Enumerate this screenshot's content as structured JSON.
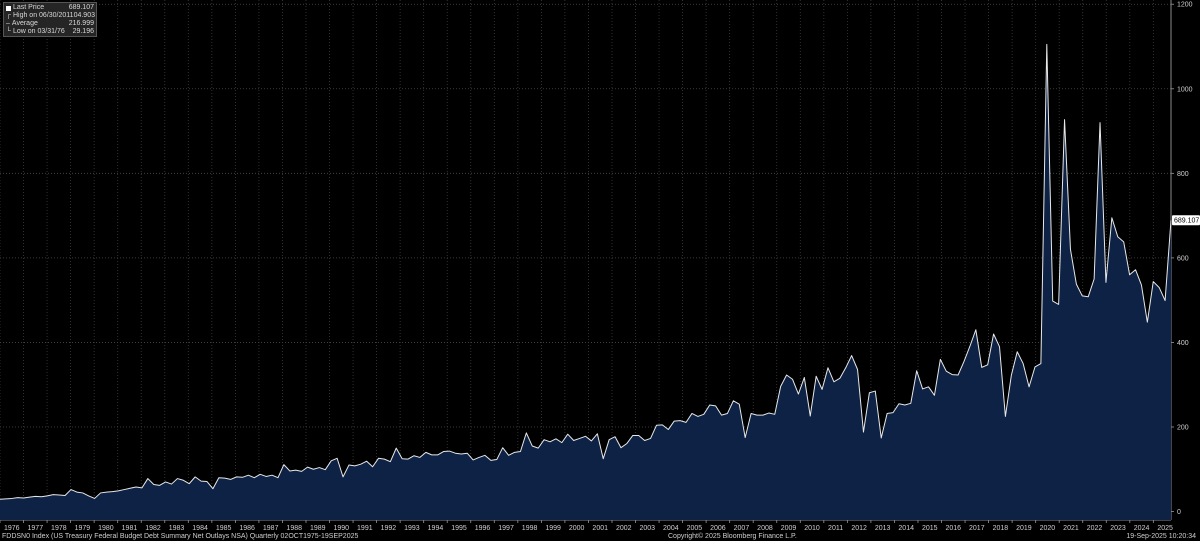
{
  "chart_data": {
    "type": "area",
    "x_start": 1976.0,
    "x_end": 2025.75,
    "x_tick_labels": [
      "1976",
      "1977",
      "1978",
      "1979",
      "1980",
      "1981",
      "1982",
      "1983",
      "1984",
      "1985",
      "1986",
      "1987",
      "1988",
      "1989",
      "1990",
      "1991",
      "1992",
      "1993",
      "1994",
      "1995",
      "1996",
      "1997",
      "1998",
      "1999",
      "2000",
      "2001",
      "2002",
      "2003",
      "2004",
      "2005",
      "2006",
      "2007",
      "2008",
      "2009",
      "2010",
      "2011",
      "2012",
      "2013",
      "2014",
      "2015",
      "2016",
      "2017",
      "2018",
      "2019",
      "2020",
      "2021",
      "2022",
      "2023",
      "2024",
      "2025"
    ],
    "ylim": [
      -20,
      1210
    ],
    "y_ticks": [
      0,
      200,
      400,
      600,
      800,
      1000,
      1200
    ],
    "grid": true,
    "fill_color": "#0d2244",
    "line_color": "#e8e8e8",
    "series": [
      {
        "values": [
          29.196,
          30,
          31,
          33,
          32,
          34,
          36,
          35,
          37,
          40,
          39,
          38,
          52,
          46,
          44,
          37,
          31,
          44,
          46,
          47,
          49,
          52,
          55,
          58,
          56,
          78,
          64,
          62,
          70,
          65,
          78,
          74,
          66,
          82,
          72,
          71,
          54,
          80,
          79,
          76,
          82,
          81,
          86,
          80,
          88,
          83,
          86,
          80,
          111,
          96,
          98,
          95,
          105,
          100,
          104,
          99,
          120,
          126,
          82,
          110,
          108,
          112,
          119,
          106,
          126,
          124,
          118,
          150,
          125,
          124,
          132,
          128,
          140,
          134,
          134,
          142,
          143,
          138,
          136,
          138,
          122,
          128,
          133,
          121,
          123,
          151,
          133,
          140,
          142,
          186,
          155,
          150,
          170,
          165,
          172,
          163,
          183,
          168,
          173,
          178,
          167,
          184,
          125,
          170,
          177,
          151,
          161,
          180,
          180,
          168,
          173,
          204,
          205,
          194,
          214,
          215,
          211,
          232,
          225,
          230,
          252,
          250,
          228,
          232,
          262,
          254,
          175,
          232,
          228,
          228,
          233,
          230,
          296,
          323,
          313,
          278,
          317,
          226,
          320,
          289,
          340,
          307,
          315,
          340,
          369,
          336,
          188,
          281,
          285,
          174,
          232,
          234,
          255,
          252,
          256,
          333,
          290,
          295,
          275,
          360,
          332,
          324,
          323,
          355,
          391,
          430,
          341,
          347,
          420,
          390,
          225,
          322,
          378,
          350,
          295,
          342,
          350,
          1104.903,
          498,
          490,
          927,
          620,
          538,
          510,
          508,
          550,
          920,
          542,
          695,
          650,
          638,
          560,
          572,
          536,
          448,
          544,
          530,
          499,
          689.107
        ]
      }
    ],
    "legend": {
      "rows": [
        {
          "label": "Last Price",
          "value": "689.107",
          "color": "#ffffff"
        },
        {
          "label": "High on 06/30/20",
          "value": "1104.903",
          "color": "#9a9a9a"
        },
        {
          "label": "Average",
          "value": "216.999",
          "color": "#9a9a9a"
        },
        {
          "label": "Low on 03/31/76",
          "value": "29.196",
          "color": "#9a9a9a"
        }
      ]
    },
    "last_price_label": "689.107"
  },
  "footer": {
    "left": "FDDSN0 Index (US Treasury Federal Budget Debt Summary Net Outlays NSA)  Quarterly 02OCT1975-19SEP2025",
    "center": "Copyright© 2025 Bloomberg Finance L.P.",
    "right": "19-Sep-2025 10:20:34"
  }
}
